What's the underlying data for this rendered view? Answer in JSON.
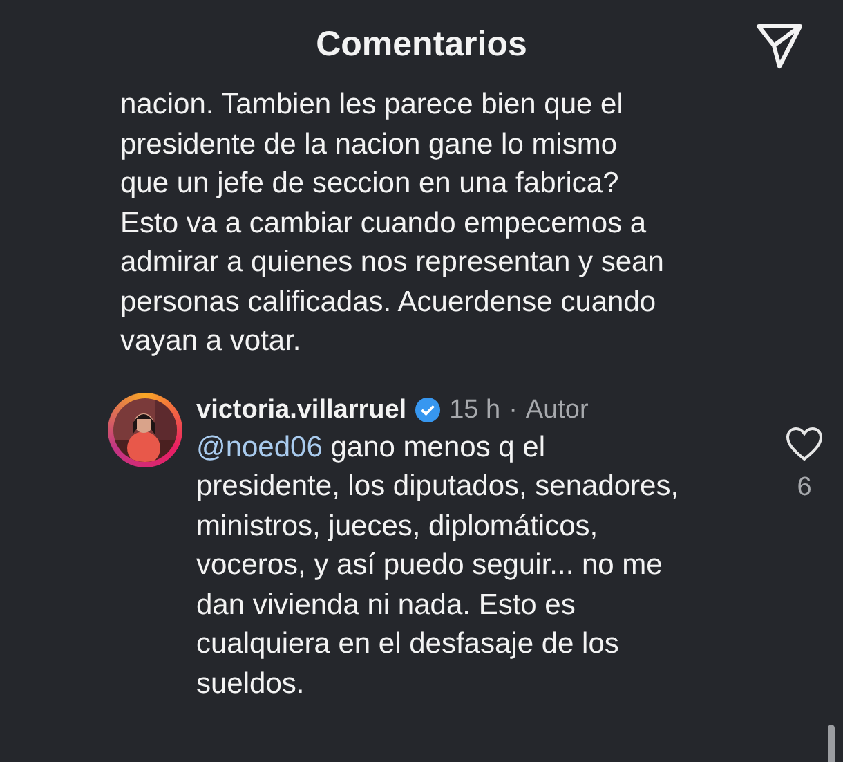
{
  "header": {
    "title": "Comentarios"
  },
  "comments": [
    {
      "text": "nacion. Tambien les parece bien que el presidente de la nacion gane lo mismo que un jefe de seccion en una fabrica? Esto va a cambiar cuando empecemos a admirar a quienes nos representan y sean personas calificadas. Acuerdense cuando vayan a votar."
    },
    {
      "username": "victoria.villarruel",
      "verified": true,
      "time": "15 h",
      "separator": "·",
      "role": "Autor",
      "mention": "@noed06",
      "text": "gano menos q el presidente, los diputados, senadores, ministros, jueces, diplomáticos, voceros, y así puedo seguir... no me dan vivienda ni nada. Esto es cualquiera en el desfasaje de los sueldos.",
      "likes": "6"
    }
  ]
}
